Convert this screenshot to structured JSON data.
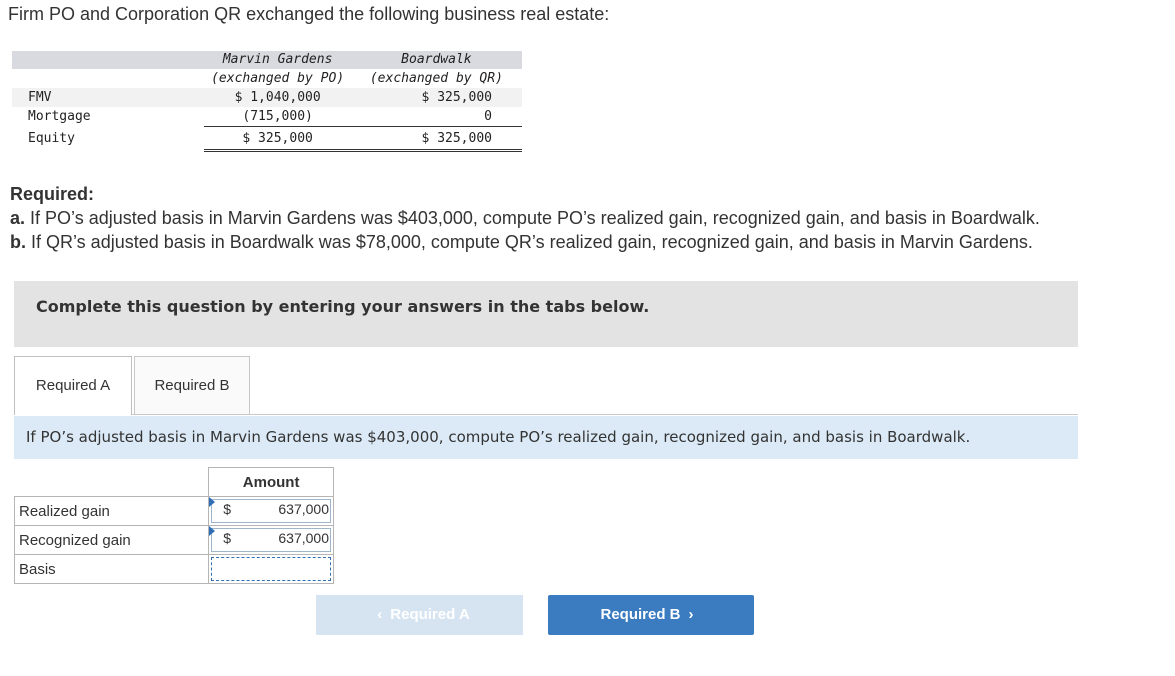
{
  "intro": "Firm PO and Corporation QR exchanged the following business real estate:",
  "property_table": {
    "col1_name": "Marvin Gardens",
    "col1_sub": "(exchanged by PO)",
    "col2_name": "Boardwalk",
    "col2_sub": "(exchanged by QR)",
    "rows": [
      {
        "label": "FMV",
        "c1": "$ 1,040,000",
        "c2": "$ 325,000"
      },
      {
        "label": "Mortgage",
        "c1": "(715,000)",
        "c2": "0"
      },
      {
        "label": "Equity",
        "c1": "$ 325,000",
        "c2": "$ 325,000"
      }
    ]
  },
  "required": {
    "heading": "Required:",
    "a_prefix": "a.",
    "a_text": " If PO’s adjusted basis in Marvin Gardens was $403,000, compute PO’s realized gain, recognized gain, and basis in Boardwalk.",
    "b_prefix": "b.",
    "b_text": " If QR’s adjusted basis in Boardwalk was $78,000, compute QR’s realized gain, recognized gain, and basis in Marvin Gardens."
  },
  "complete_text": "Complete this question by entering your answers in the tabs below.",
  "tabs": [
    {
      "label": "Required A",
      "active": true
    },
    {
      "label": "Required B",
      "active": false
    }
  ],
  "prompt": "If PO’s adjusted basis in Marvin Gardens was $403,000, compute PO’s realized gain, recognized gain, and basis in Boardwalk.",
  "answer_table": {
    "header": "Amount",
    "rows": [
      {
        "label": "Realized gain",
        "currency": "$",
        "value": "637,000"
      },
      {
        "label": "Recognized gain",
        "currency": "$",
        "value": "637,000"
      },
      {
        "label": "Basis",
        "currency": "",
        "value": ""
      }
    ]
  },
  "nav": {
    "prev_label": "Required A",
    "next_label": "Required B",
    "prev_icon": "chevron-left-icon",
    "next_icon": "chevron-right-icon"
  },
  "colors": {
    "accent": "#3b7bc0",
    "prompt_bg": "#dbeaf6",
    "complete_bg": "#e3e3e3"
  }
}
